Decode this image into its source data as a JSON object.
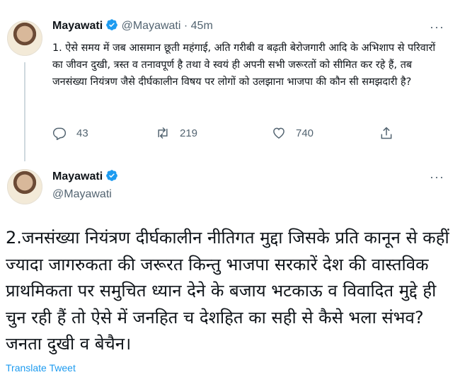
{
  "tweet1": {
    "name": "Mayawati",
    "handle": "@Mayawati",
    "separator": "·",
    "time": "45m",
    "text": "1. ऐसे समय में जब आसमान छूती महंगाई, अति गरीबी व बढ़ती बेरोजगारी आदि के अभिशाप से परिवारों का जीवन दुखी, त्रस्त व तनावपूर्ण है तथा वे स्वयं ही अपनी सभी जरूरतों को सीमित कर रहे हैं, तब जनसंख्या नियंत्रण जैसे दीर्घकालीन विषय पर लोगों को उलझाना भाजपा की कौन सी समझदारी है?",
    "replies": "43",
    "retweets": "219",
    "likes": "740",
    "more_label": "···"
  },
  "tweet2": {
    "name": "Mayawati",
    "handle": "@Mayawati",
    "text": "2.जनसंख्या नियंत्रण दीर्घकालीन नीतिगत मुद्दा जिसके प्रति कानून से कहीं ज्यादा जागरुकता की जरूरत किन्तु भाजपा सरकारें देश की वास्तविक प्राथमिकता पर समुचित ध्यान देने के बजाय भटकाऊ व विवादित मुद्दे ही चुन रही हैं तो ऐसे में जनहित च देशहित का सही से कैसे भला संभव? जनता दुखी व बेचैन।",
    "translate_label": "Translate Tweet",
    "more_label": "···"
  },
  "icons": {
    "verified": "verified-badge-icon",
    "reply": "reply-icon",
    "retweet": "retweet-icon",
    "like": "heart-icon",
    "share": "share-icon",
    "more": "more-icon"
  },
  "colors": {
    "accent": "#1d9bf0",
    "text": "#0f1419",
    "secondary": "#536471"
  }
}
